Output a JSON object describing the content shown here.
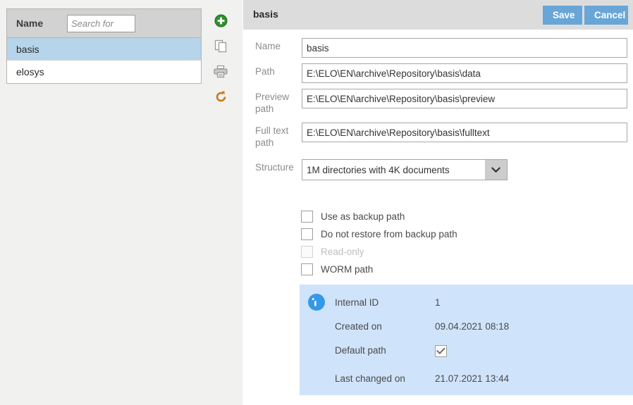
{
  "list_panel": {
    "column_header": "Name",
    "search": {
      "placeholder": "Search for",
      "value": ""
    },
    "rows": [
      {
        "label": "basis",
        "selected": true
      },
      {
        "label": "elosys",
        "selected": false
      }
    ]
  },
  "toolbar": {
    "items": [
      {
        "name": "add-icon",
        "tooltip": "Add"
      },
      {
        "name": "copy-icon",
        "tooltip": "Copy"
      },
      {
        "name": "print-icon",
        "tooltip": "Print"
      },
      {
        "name": "refresh-icon",
        "tooltip": "Refresh"
      }
    ]
  },
  "detail": {
    "title": "basis",
    "save_label": "Save",
    "cancel_label": "Cancel",
    "fields": {
      "name_label": "Name",
      "name_value": "basis",
      "path_label": "Path",
      "path_value": "E:\\ELO\\EN\\archive\\Repository\\basis\\data",
      "preview_label": "Preview path",
      "preview_value": "E:\\ELO\\EN\\archive\\Repository\\basis\\preview",
      "fulltext_label": "Full text path",
      "fulltext_value": "E:\\ELO\\EN\\archive\\Repository\\basis\\fulltext",
      "structure_label": "Structure",
      "structure_value": "1M directories with 4K documents",
      "structure_options": [
        "1M directories with 4K documents"
      ]
    },
    "checkboxes": [
      {
        "label": "Use as backup path",
        "checked": false,
        "disabled": false
      },
      {
        "label": "Do not restore from backup path",
        "checked": false,
        "disabled": false
      },
      {
        "label": "Read-only",
        "checked": false,
        "disabled": true
      },
      {
        "label": "WORM path",
        "checked": false,
        "disabled": false
      }
    ],
    "info": {
      "rows": [
        {
          "key": "Internal ID",
          "value": "1",
          "type": "text"
        },
        {
          "key": "Created on",
          "value": "09.04.2021 08:18",
          "type": "text"
        },
        {
          "key": "Default path",
          "value": "",
          "type": "checkbox-checked"
        },
        {
          "key": "Last changed on",
          "value": "21.07.2021 13:44",
          "type": "text"
        }
      ]
    }
  },
  "colors": {
    "accent_blue": "#68a6d8",
    "selected_row": "#b6d4ea",
    "info_panel": "#cfe3fa",
    "header_gray": "#dcdcdc",
    "panel_gray": "#f1f1f0",
    "add_green": "#2f8f2f",
    "refresh_orange": "#c87820"
  }
}
